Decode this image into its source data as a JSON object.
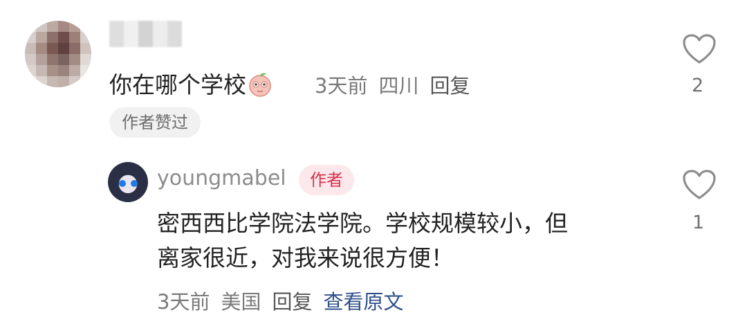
{
  "comment": {
    "text": "你在哪个学校",
    "emoji": "peach-face-emoji",
    "time": "3天前",
    "location": "四川",
    "reply_label": "回复",
    "author_liked": "作者赞过",
    "likes": "2"
  },
  "reply": {
    "username": "youngmabel",
    "author_tag": "作者",
    "text_line1": "密西西比学院法学院。学校规模较小，但",
    "text_line2": "离家很近，对我来说很方便！",
    "time": "3天前",
    "location": "美国",
    "reply_label": "回复",
    "view_original": "查看原文",
    "likes": "1"
  },
  "colors": {
    "meta_gray": "#7a7a7a",
    "author_tag_bg": "#fde9ec",
    "author_tag_text": "#d8324e",
    "link_blue": "#2f4f8a"
  }
}
